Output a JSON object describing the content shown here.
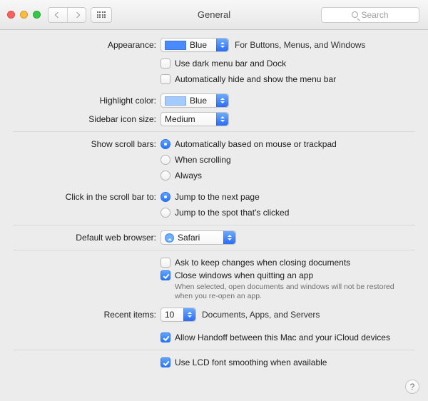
{
  "window": {
    "title": "General",
    "search_placeholder": "Search"
  },
  "appearance": {
    "label": "Appearance:",
    "value": "Blue",
    "hint": "For Buttons, Menus, and Windows",
    "dark_menu_label": "Use dark menu bar and Dock",
    "auto_hide_label": "Automatically hide and show the menu bar"
  },
  "highlight": {
    "label": "Highlight color:",
    "value": "Blue"
  },
  "sidebar": {
    "label": "Sidebar icon size:",
    "value": "Medium"
  },
  "scrollbars": {
    "label": "Show scroll bars:",
    "o1": "Automatically based on mouse or trackpad",
    "o2": "When scrolling",
    "o3": "Always"
  },
  "click_scroll": {
    "label": "Click in the scroll bar to:",
    "o1": "Jump to the next page",
    "o2": "Jump to the spot that's clicked"
  },
  "browser": {
    "label": "Default web browser:",
    "value": "Safari"
  },
  "docs": {
    "ask_label": "Ask to keep changes when closing documents",
    "close_label": "Close windows when quitting an app",
    "close_sub": "When selected, open documents and windows will not be restored when you re-open an app."
  },
  "recent": {
    "label": "Recent items:",
    "value": "10",
    "hint": "Documents, Apps, and Servers"
  },
  "handoff": {
    "label": "Allow Handoff between this Mac and your iCloud devices"
  },
  "lcd": {
    "label": "Use LCD font smoothing when available"
  },
  "help": "?"
}
